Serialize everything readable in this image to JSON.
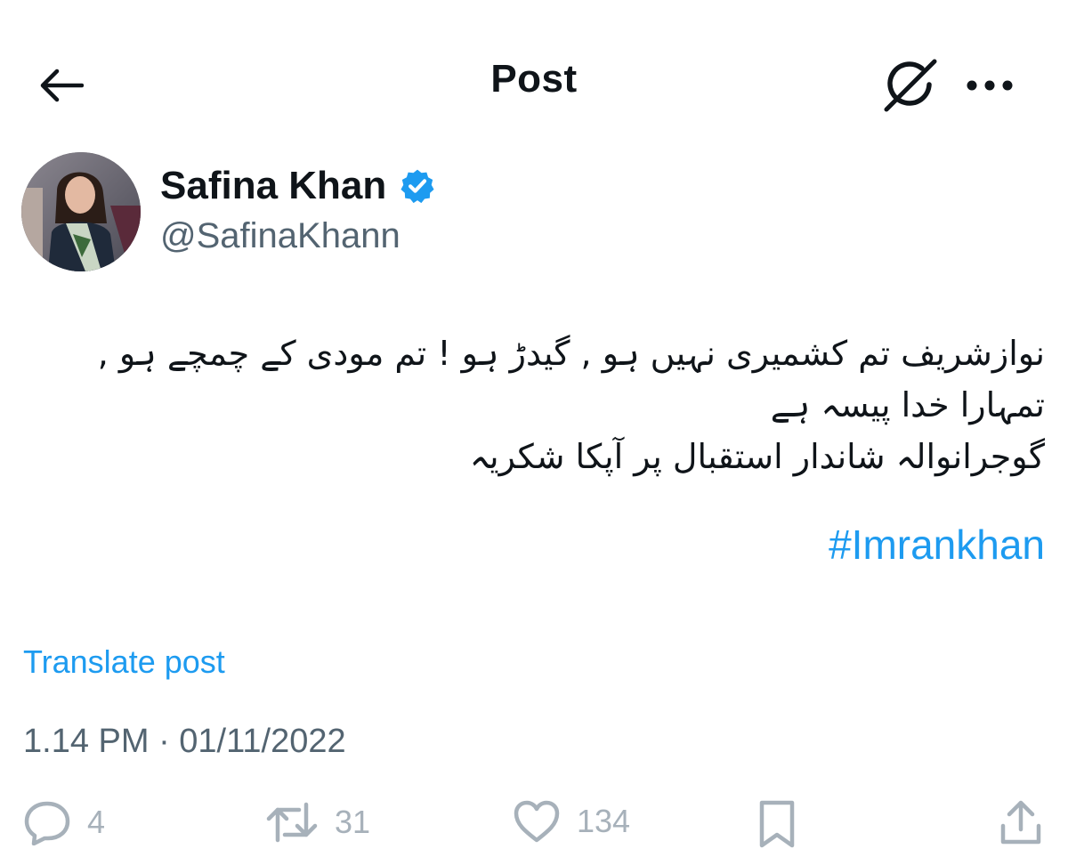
{
  "header": {
    "title": "Post",
    "back_icon": "arrow-left-icon",
    "grok_icon": "grok-icon",
    "more_icon": "more-dots-icon"
  },
  "author": {
    "display_name": "Safina Khan",
    "handle": "@SafinaKhann",
    "verified": true,
    "verified_color": "#1d9bf0"
  },
  "post": {
    "lines": [
      "نوازشریف تم کشمیری نہیں ہو , گیدڑ ہو ! تم مودی کے چمچے ہو , تمہارا خدا پیسہ ہے",
      "گوجرانوالہ شاندار استقبال پر آپکا شکریہ"
    ],
    "hashtag": "#Imrankhan",
    "translate_label": "Translate post",
    "timestamp": "1.14 PM · 01/11/2022"
  },
  "actions": {
    "reply_count": "4",
    "repost_count": "31",
    "like_count": "134",
    "icons": [
      "reply-icon",
      "repost-icon",
      "like-icon",
      "bookmark-icon",
      "share-icon"
    ]
  },
  "colors": {
    "link": "#1d9bf0",
    "secondary_text": "#536471",
    "action_icon": "#a7b1ba"
  }
}
